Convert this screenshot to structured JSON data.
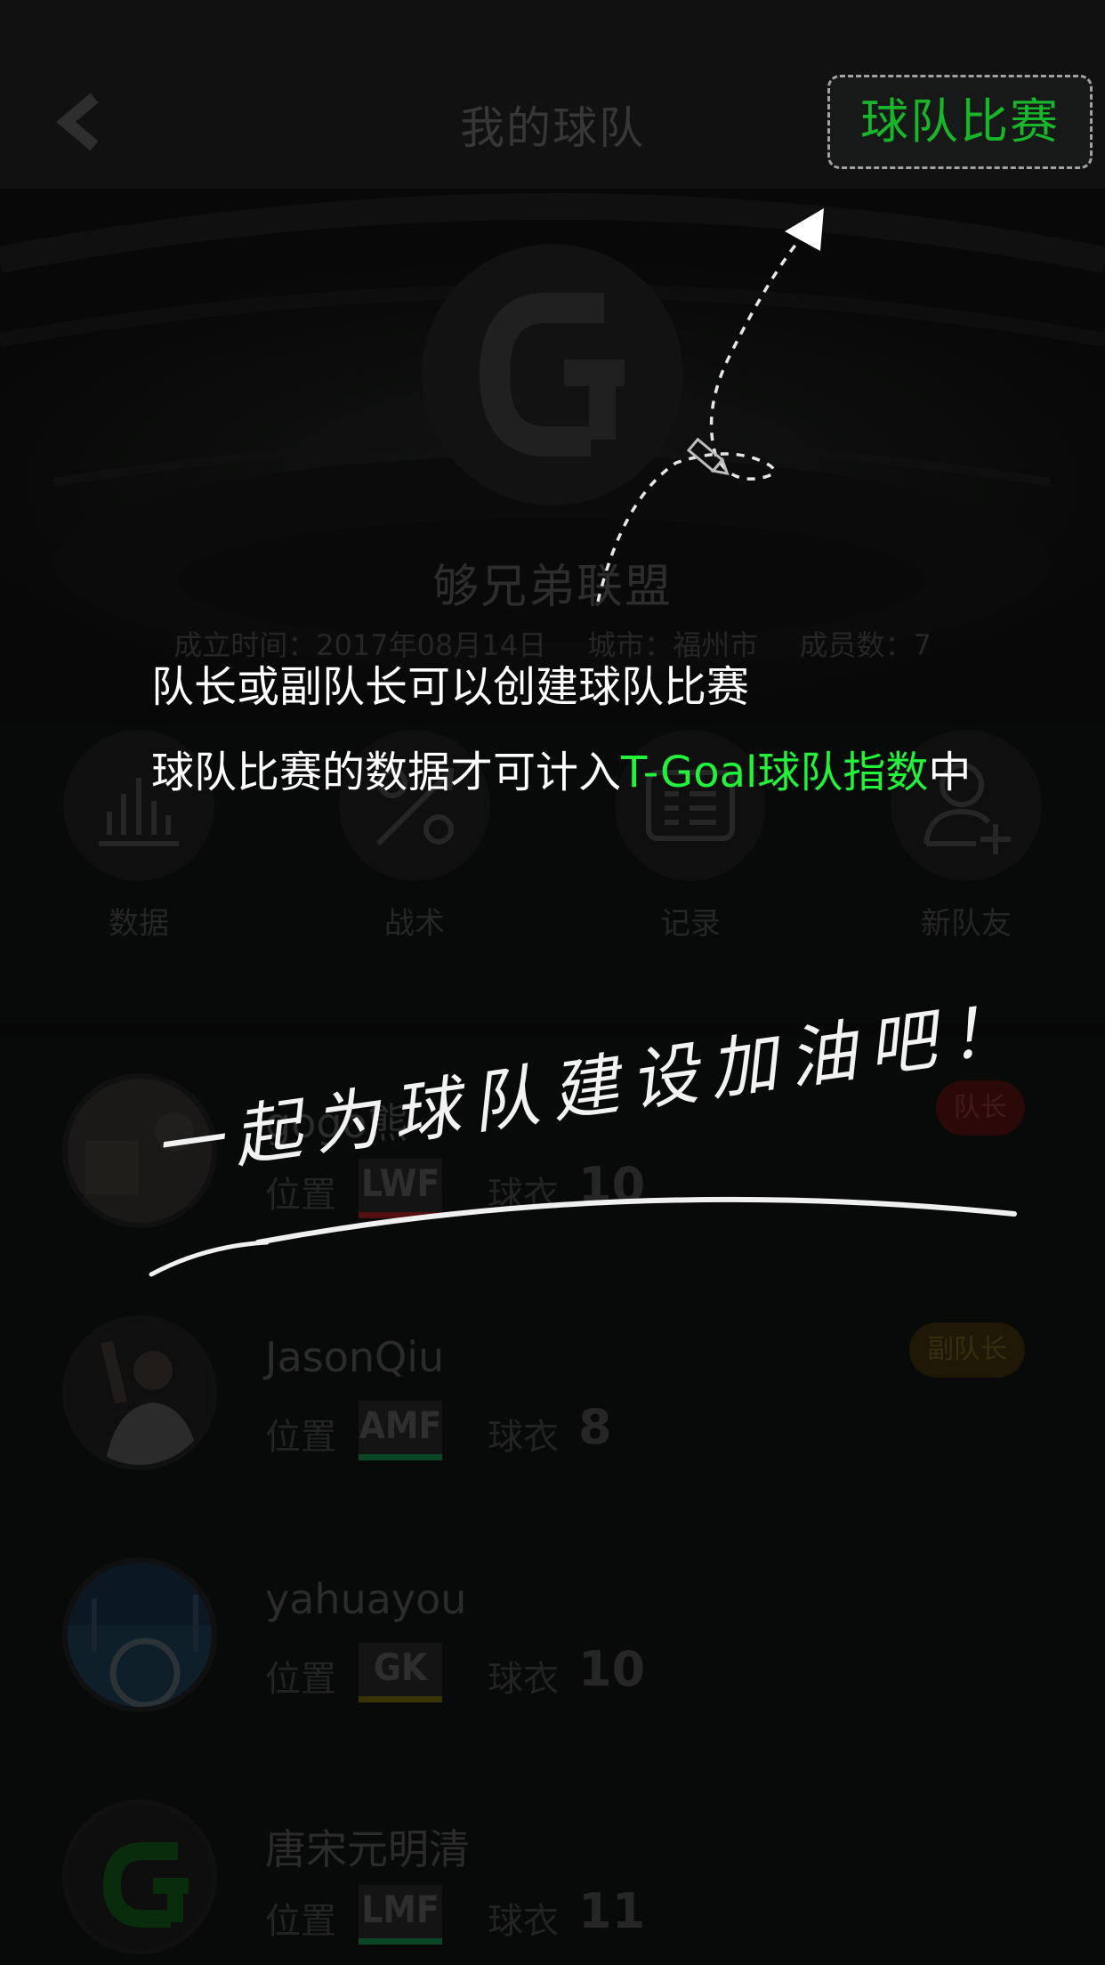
{
  "header": {
    "title": "我的球队",
    "match_button": "球队比赛"
  },
  "team": {
    "name": "够兄弟联盟",
    "founded": "成立时间：2017年08月14日",
    "city": "城市：福州市",
    "members": "成员数：7"
  },
  "actions": [
    {
      "label": "数据",
      "icon": "bar-chart-icon"
    },
    {
      "label": "战术",
      "icon": "tactics-icon"
    },
    {
      "label": "记录",
      "icon": "record-icon"
    },
    {
      "label": "新队友",
      "icon": "add-member-icon"
    }
  ],
  "members": [
    {
      "name": "gogo熊",
      "pos_label": "位置",
      "position": "LWF",
      "jersey_label": "球衣",
      "jersey": "10",
      "badge": "队长",
      "pos_color": "#6e1616"
    },
    {
      "name": "JasonQiu",
      "pos_label": "位置",
      "position": "AMF",
      "jersey_label": "球衣",
      "jersey": "8",
      "badge": "副队长",
      "pos_color": "#0f5e37"
    },
    {
      "name": "yahuayou",
      "pos_label": "位置",
      "position": "GK",
      "jersey_label": "球衣",
      "jersey": "10",
      "badge": "",
      "pos_color": "#4d4407"
    },
    {
      "name": "唐宋元明清",
      "pos_label": "位置",
      "position": "LMF",
      "jersey_label": "球衣",
      "jersey": "11",
      "badge": "",
      "pos_color": "#0f5e37"
    }
  ],
  "overlay": {
    "tip_line1": "队长或副队长可以创建球队比赛",
    "tip_line2_prefix": "球队比赛的数据才可计入",
    "tip_line2_highlight": "T-Goal球队指数",
    "tip_line2_suffix": "中",
    "slogan": "一起为球队建设加油吧！",
    "highlight_color": "#22f23a"
  }
}
